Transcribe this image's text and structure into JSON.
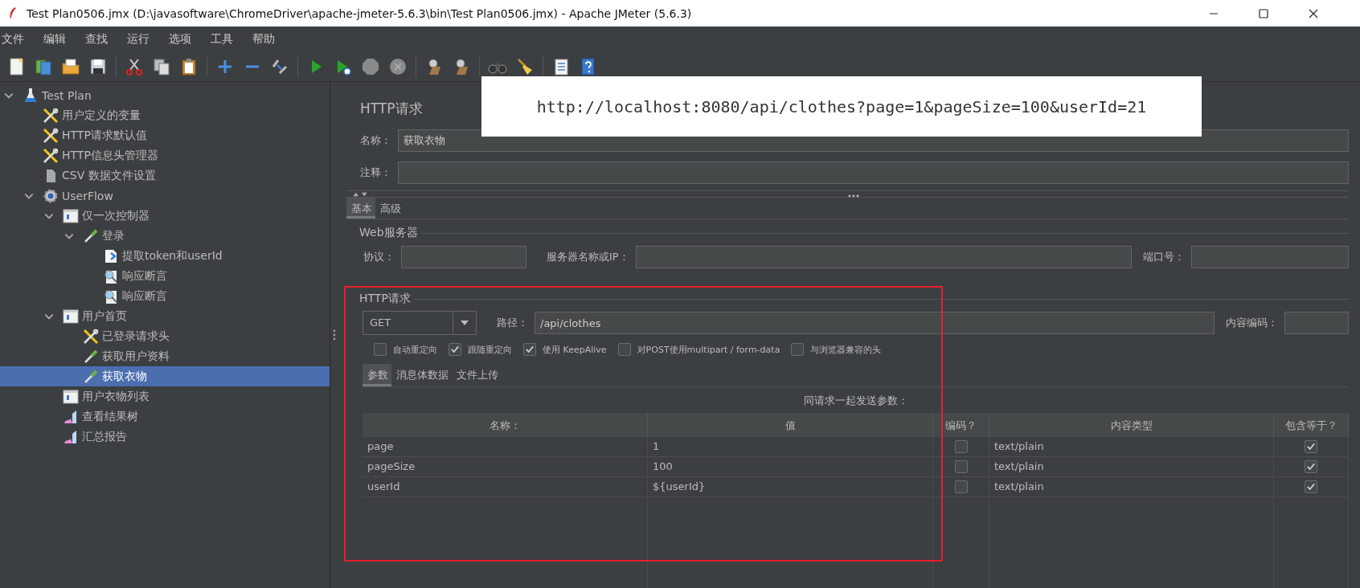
{
  "window": {
    "title": "Test Plan0506.jmx (D:\\javasoftware\\ChromeDriver\\apache-jmeter-5.6.3\\bin\\Test Plan0506.jmx) - Apache JMeter (5.6.3)"
  },
  "menu": [
    "文件",
    "编辑",
    "查找",
    "运行",
    "选项",
    "工具",
    "帮助"
  ],
  "tree": [
    {
      "label": "Test Plan",
      "kind": "plan",
      "selected": false,
      "expanded": true,
      "children": [
        {
          "label": "用户定义的变量",
          "kind": "config",
          "selected": false
        },
        {
          "label": "HTTP请求默认值",
          "kind": "config",
          "selected": false
        },
        {
          "label": "HTTP信息头管理器",
          "kind": "config",
          "selected": false
        },
        {
          "label": "CSV 数据文件设置",
          "kind": "csv",
          "selected": false
        },
        {
          "label": "UserFlow",
          "kind": "thread-group",
          "selected": false,
          "expanded": true,
          "children": [
            {
              "label": "仅一次控制器",
              "kind": "controller",
              "selected": false,
              "expanded": true,
              "children": [
                {
                  "label": "登录",
                  "kind": "sampler",
                  "selected": false,
                  "expanded": true,
                  "children": [
                    {
                      "label": "提取token和userId",
                      "kind": "extractor",
                      "selected": false
                    },
                    {
                      "label": "响应断言",
                      "kind": "assertion",
                      "selected": false
                    },
                    {
                      "label": "响应断言",
                      "kind": "assertion",
                      "selected": false
                    }
                  ]
                }
              ]
            },
            {
              "label": "用户首页",
              "kind": "controller",
              "selected": false,
              "expanded": true,
              "children": [
                {
                  "label": "已登录请求头",
                  "kind": "config",
                  "selected": false
                },
                {
                  "label": "获取用户资料",
                  "kind": "sampler",
                  "selected": false
                },
                {
                  "label": "获取衣物",
                  "kind": "sampler",
                  "selected": true
                }
              ]
            },
            {
              "label": "用户衣物列表",
              "kind": "controller",
              "selected": false
            },
            {
              "label": "查看结果树",
              "kind": "listener",
              "selected": false
            },
            {
              "label": "汇总报告",
              "kind": "listener",
              "selected": false
            }
          ]
        }
      ]
    }
  ],
  "panel": {
    "title": "HTTP请求",
    "name_label": "名称：",
    "name_value": "获取衣物",
    "comment_label": "注释：",
    "tabs": [
      {
        "label": "基本",
        "selected": true
      },
      {
        "label": "高级",
        "selected": false
      }
    ],
    "web_server": {
      "title": "Web服务器",
      "protocol_label": "协议：",
      "server_label": "服务器名称或IP：",
      "port_label": "端口号："
    },
    "http_request": {
      "title": "HTTP请求",
      "method": "GET",
      "path_label": "路径：",
      "path_value": "/api/clothes",
      "encoding_label": "内容编码：",
      "options": [
        {
          "label": "自动重定向",
          "checked": false
        },
        {
          "label": "跟随重定向",
          "checked": true
        },
        {
          "label": "使用 KeepAlive",
          "checked": true
        },
        {
          "label": "对POST使用multipart / form-data",
          "checked": false
        },
        {
          "label": "与浏览器兼容的头",
          "checked": false
        }
      ],
      "subtabs": [
        {
          "label": "参数",
          "selected": true
        },
        {
          "label": "消息体数据",
          "selected": false
        },
        {
          "label": "文件上传",
          "selected": false
        }
      ],
      "params_caption": "同请求一起发送参数：",
      "columns": [
        "名称：",
        "值",
        "编码？",
        "内容类型",
        "包含等于？"
      ],
      "rows": [
        {
          "name": "page",
          "value": "1",
          "encode": false,
          "content_type": "text/plain",
          "include_equals": true
        },
        {
          "name": "pageSize",
          "value": "100",
          "encode": false,
          "content_type": "text/plain",
          "include_equals": true
        },
        {
          "name": "userId",
          "value": "${userId}",
          "encode": false,
          "content_type": "text/plain",
          "include_equals": true
        }
      ]
    }
  },
  "callout": {
    "text": "http://localhost:8080/api/clothes?page=1&pageSize=100&userId=21"
  }
}
